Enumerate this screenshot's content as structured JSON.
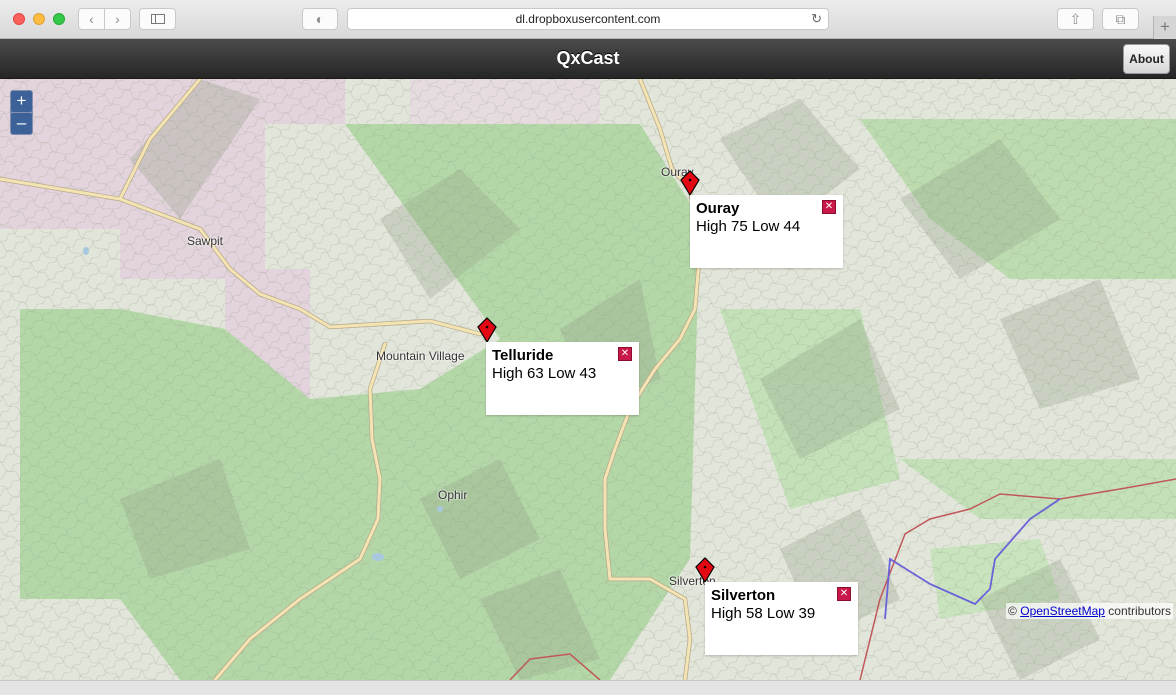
{
  "browser": {
    "url": "dl.dropboxusercontent.com",
    "back_icon": "‹",
    "forward_icon": "›",
    "newtab_icon": "+",
    "reload_icon": "↻",
    "share_icon": "⇧",
    "tabs_icon": "⧉",
    "privacy_icon": "◐"
  },
  "app": {
    "title": "QxCast",
    "about_label": "About"
  },
  "map": {
    "zoom_in": "+",
    "zoom_out": "–",
    "places": {
      "sawpit": "Sawpit",
      "mountain_village": "Mountain Village",
      "ophir": "Ophir",
      "ouray_town": "Ouray",
      "silverton_town": "Silverton"
    },
    "popups": [
      {
        "name": "Ouray",
        "temps": "High 75 Low 44",
        "close": "✕"
      },
      {
        "name": "Telluride",
        "temps": "High 63 Low 43",
        "close": "✕"
      },
      {
        "name": "Silverton",
        "temps": "High 58 Low 39",
        "close": "✕"
      }
    ],
    "attribution": {
      "prefix": "©",
      "link": "OpenStreetMap",
      "suffix": "contributors"
    },
    "colors": {
      "forest": "#b4d7a8",
      "terrain": "#e2e5da",
      "urban_land": "#e3d3dc",
      "road": "#f4e4b4",
      "state_line": "#c0585a",
      "river_line": "#6a62d8",
      "marker": "#e30613"
    }
  }
}
